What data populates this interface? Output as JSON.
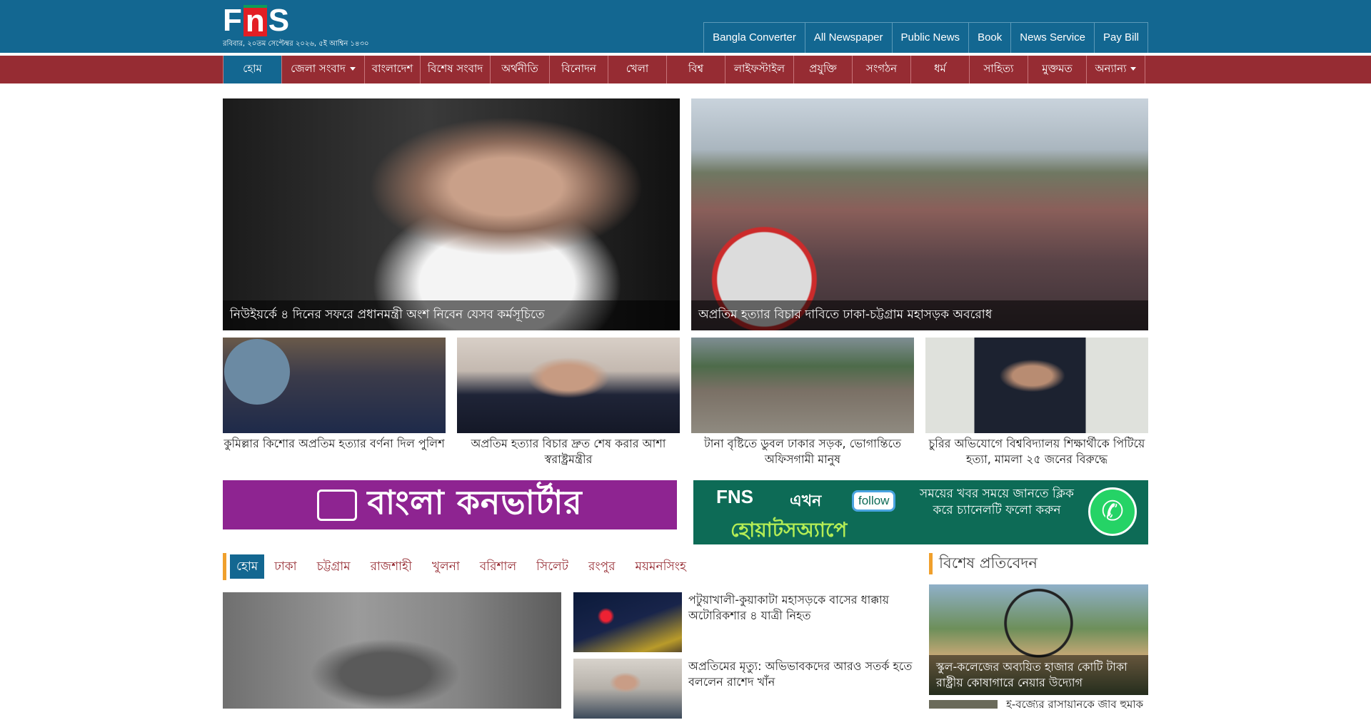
{
  "header": {
    "logo_text": "FNS",
    "date_line": "রবিবার, ২০তম সেপ্টেম্বর ২০২৬, ৫ই আশ্বিন ১৪৩০",
    "top_links": [
      "Bangla Converter",
      "All Newspaper",
      "Public News",
      "Book",
      "News Service",
      "Pay Bill"
    ]
  },
  "nav": {
    "items": [
      {
        "label": "হোম",
        "active": true
      },
      {
        "label": "জেলা সংবাদ",
        "dropdown": true
      },
      {
        "label": "বাংলাদেশ"
      },
      {
        "label": "বিশেষ সংবাদ"
      },
      {
        "label": "অর্থনীতি"
      },
      {
        "label": "বিনোদন"
      },
      {
        "label": "খেলা"
      },
      {
        "label": "বিশ্ব"
      },
      {
        "label": "লাইফস্টাইল"
      },
      {
        "label": "প্রযুক্তি"
      },
      {
        "label": "সংগঠন"
      },
      {
        "label": "ধর্ম"
      },
      {
        "label": "সাহিত্য"
      },
      {
        "label": "মুক্তমত"
      },
      {
        "label": "অন্যান্য",
        "dropdown": true
      }
    ]
  },
  "hero": [
    {
      "caption": "নিউইয়র্কে ৪ দিনের সফরে প্রধানমন্ত্রী অংশ নিবেন যেসব কর্মসূচিতে"
    },
    {
      "caption": "অপ্রতিম হত্যার বিচার দাবিতে ঢাকা-চট্টগ্রাম মহাসড়ক অবরোধ"
    }
  ],
  "thumbs": [
    {
      "title": "কুমিল্লার কিশোর অপ্রতিম হত্যার বর্ণনা দিল পুলিশ"
    },
    {
      "title": "অপ্রতিম হত্যার বিচার দ্রুত শেষ করার আশা স্বরাষ্ট্রমন্ত্রীর"
    },
    {
      "title": "টানা বৃষ্টিতে ডুবল ঢাকার সড়ক, ভোগান্তিতে অফিসগামী মানুষ"
    },
    {
      "title": "চুরির অভিযোগে বিশ্ববিদ্যালয় শিক্ষার্থীকে পিটিয়ে হত্যা, মামলা ২৫ জনের বিরুদ্ধে"
    }
  ],
  "banners": {
    "left_text": "বাংলা কনভার্টার",
    "right": {
      "logo": "FNS",
      "ekhon": "এখন",
      "whatsapp": "হোয়াটসঅ্যাপে",
      "follow": "follow",
      "message": "সময়ের খবর সময়ে জানতে ক্লিক করে চ্যানেলটি ফলো করুন"
    }
  },
  "division_tabs": [
    "হোম",
    "ঢাকা",
    "চট্টগ্রাম",
    "রাজশাহী",
    "খুলনা",
    "বরিশাল",
    "সিলেট",
    "রংপুর",
    "ময়মনসিংহ"
  ],
  "list_news": [
    {
      "title": "পটুয়াখালী-কুয়াকাটা মহাসড়কে বাসের ধাক্কায় অটোরিকশার ৪ যাত্রী নিহত"
    },
    {
      "title": "অপ্রতিমের মৃত্যু: অভিভাবকদের আরও সতর্ক হতে বললেন রাশেদ খাঁন"
    }
  ],
  "sidebar": {
    "heading": "বিশেষ প্রতিবেদন",
    "card_caption": "স্কুল-কলেজের অব্যয়িত হাজার কোটি টাকা রাষ্ট্রীয় কোষাগারে নেয়ার উদ্যোগ",
    "next_title": "ই-বর্জ্যের রাসায়নিকে জীব হুমকি"
  }
}
